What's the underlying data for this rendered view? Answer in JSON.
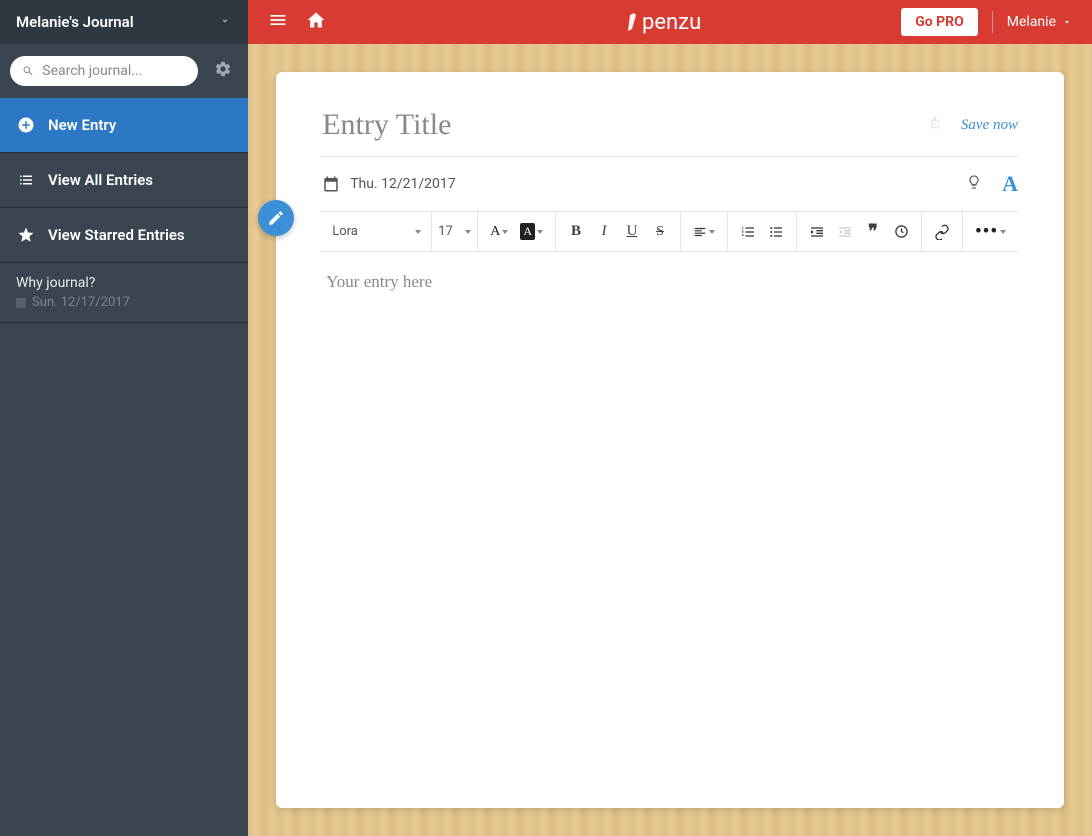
{
  "sidebar": {
    "journal_name": "Melanie's Journal",
    "search_placeholder": "Search journal...",
    "new_entry_label": "New Entry",
    "items": [
      {
        "label": "View All Entries"
      },
      {
        "label": "View Starred Entries"
      }
    ],
    "entries": [
      {
        "title": "Why journal?",
        "date": "Sun. 12/17/2017"
      }
    ]
  },
  "topbar": {
    "go_pro_label": "Go PRO",
    "user_name": "Melanie",
    "logo_text": "penzu"
  },
  "editor": {
    "title_placeholder": "Entry Title",
    "save_label": "Save now",
    "date": "Thu. 12/21/2017",
    "body_placeholder": "Your entry here",
    "font_name": "Lora",
    "font_size": "17"
  },
  "colors": {
    "accent_red": "#d73b32",
    "accent_blue": "#3a8fd6",
    "sidebar_bg": "#3a454f"
  }
}
